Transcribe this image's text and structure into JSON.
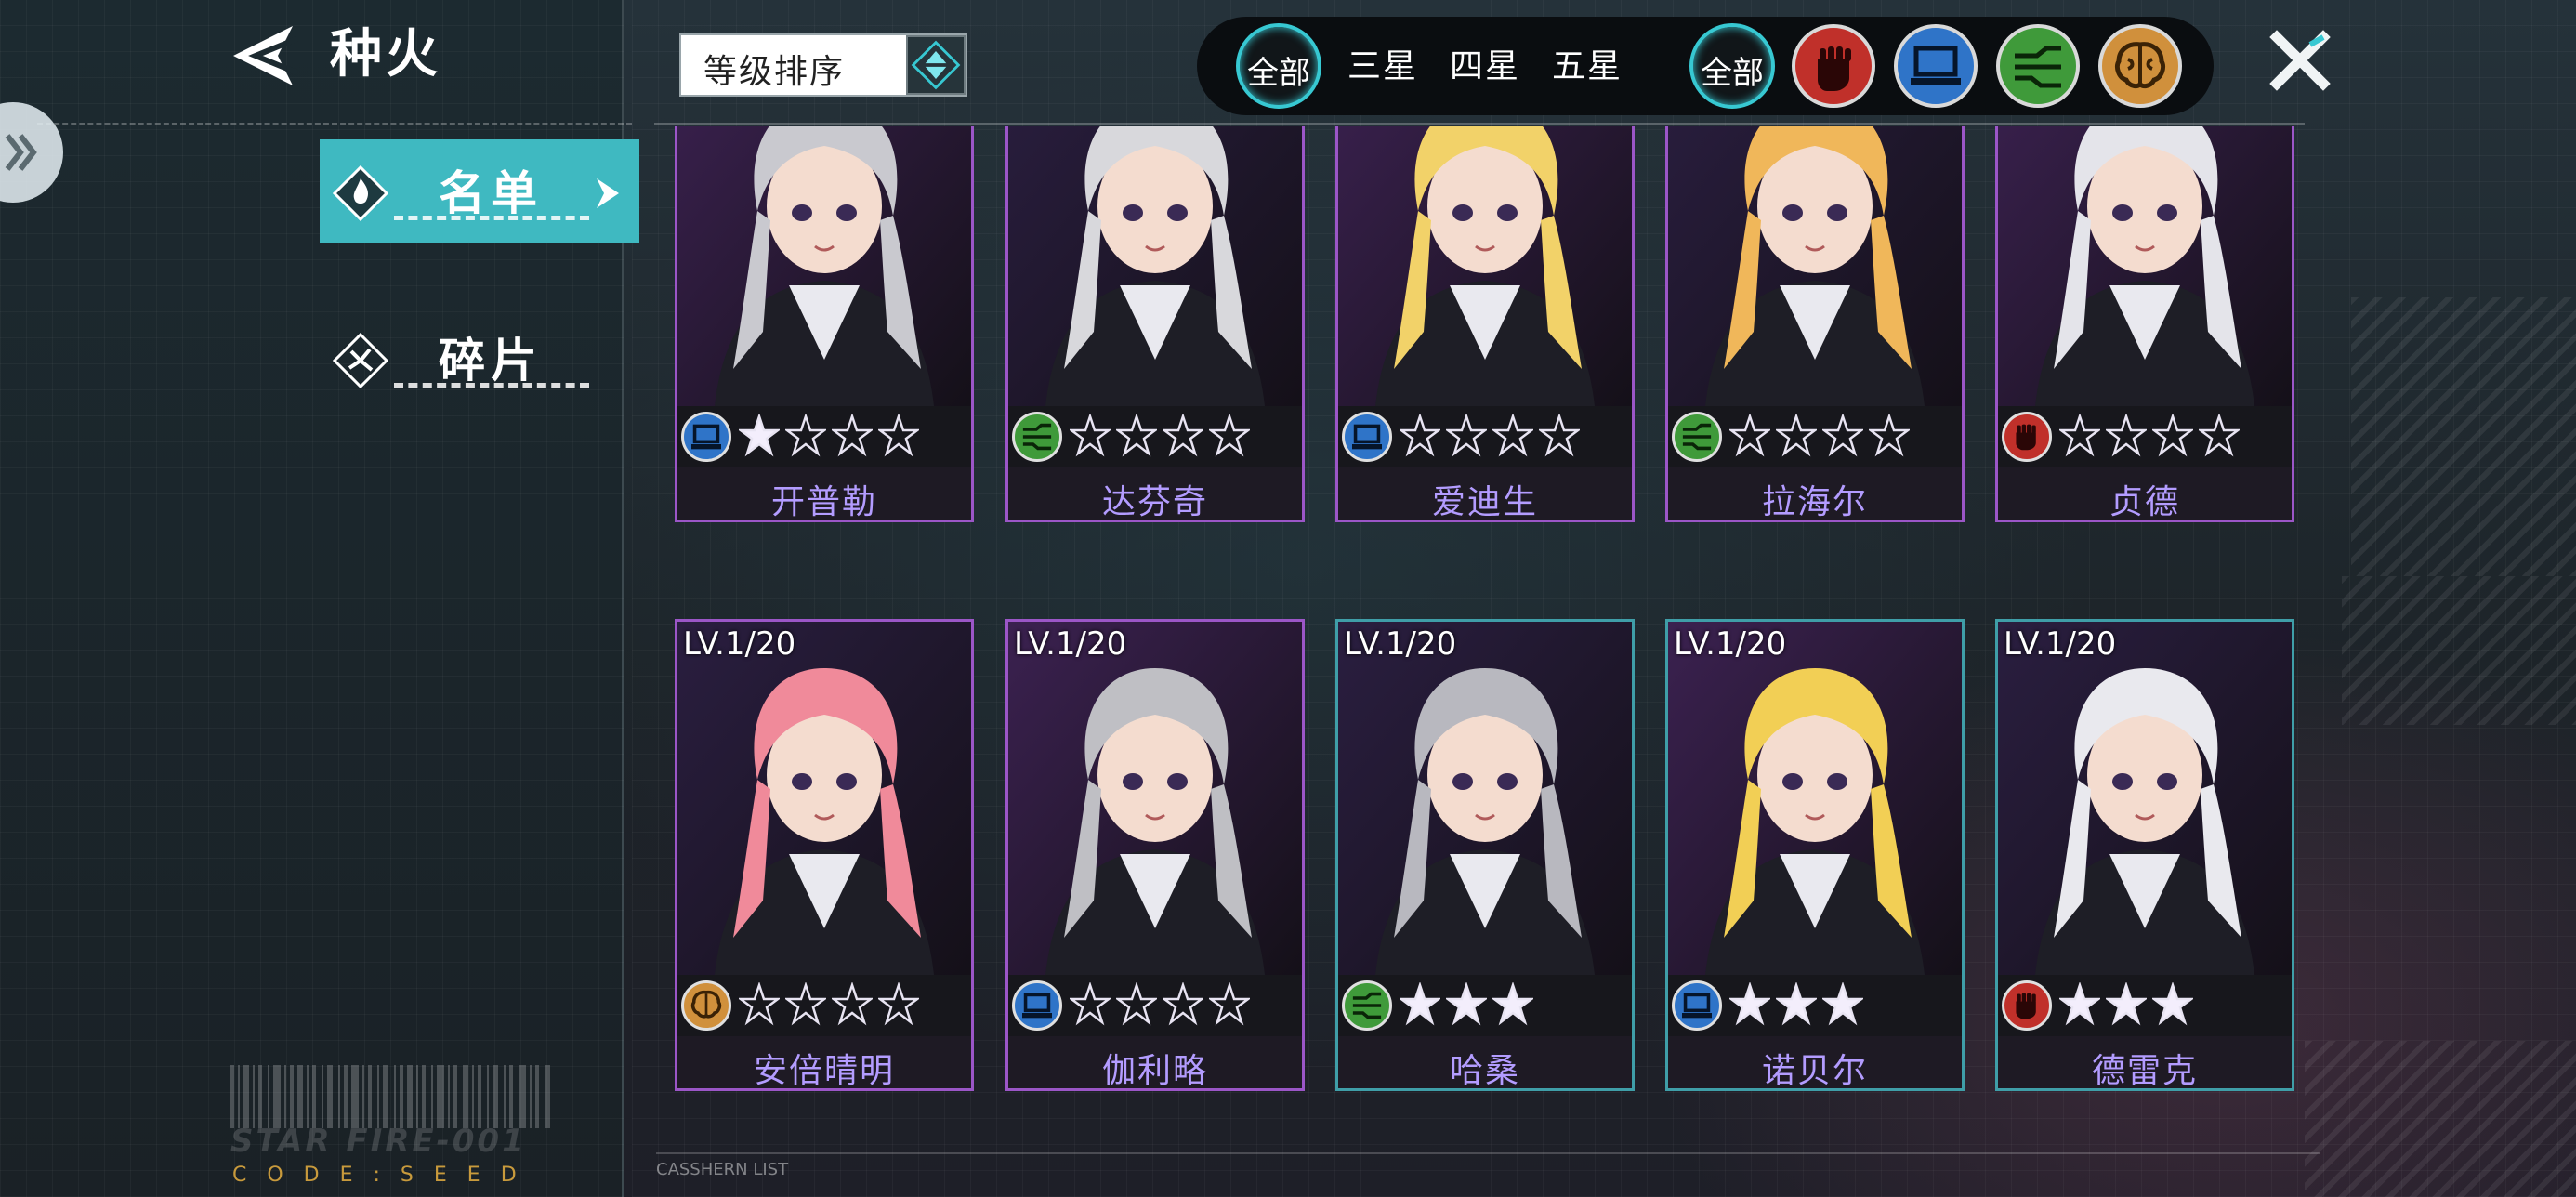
{
  "header": {
    "title": "种火"
  },
  "nav": {
    "tabs": [
      {
        "label": "名单",
        "selected": true
      },
      {
        "label": "碎片",
        "selected": false
      }
    ]
  },
  "sort": {
    "label": "等级排序"
  },
  "filters": {
    "rarity": [
      "全部",
      "三星",
      "四星",
      "五星"
    ],
    "type_all": "全部",
    "types": [
      {
        "icon": "fist-icon",
        "color": "#c0302a"
      },
      {
        "icon": "computer-icon",
        "color": "#2f74c8"
      },
      {
        "icon": "wave-icon",
        "color": "#3f9a3a"
      },
      {
        "icon": "brain-icon",
        "color": "#d0903c"
      }
    ],
    "accent_color": "#37c8d2"
  },
  "cards": [
    {
      "name": "开普勒",
      "level": "",
      "stars": 4,
      "filled_stars": 1,
      "type_icon": "computer-icon",
      "type_color": "#2f74c8",
      "hair": "#c9c9cf",
      "border": "purple"
    },
    {
      "name": "达芬奇",
      "level": "",
      "stars": 4,
      "filled_stars": 0,
      "type_icon": "wave-icon",
      "type_color": "#3f9a3a",
      "hair": "#d8d8dc",
      "border": "purple"
    },
    {
      "name": "爱迪生",
      "level": "",
      "stars": 4,
      "filled_stars": 0,
      "type_icon": "computer-icon",
      "type_color": "#2f74c8",
      "hair": "#f2d269",
      "border": "purple"
    },
    {
      "name": "拉海尔",
      "level": "",
      "stars": 4,
      "filled_stars": 0,
      "type_icon": "wave-icon",
      "type_color": "#3f9a3a",
      "hair": "#f0b75a",
      "border": "purple"
    },
    {
      "name": "贞德",
      "level": "",
      "stars": 4,
      "filled_stars": 0,
      "type_icon": "fist-icon",
      "type_color": "#c0302a",
      "hair": "#e4e4ea",
      "border": "purple"
    },
    {
      "name": "安倍晴明",
      "level": "LV.1/20",
      "stars": 4,
      "filled_stars": 0,
      "type_icon": "brain-icon",
      "type_color": "#d0903c",
      "hair": "#f08a9a",
      "border": "purple"
    },
    {
      "name": "伽利略",
      "level": "LV.1/20",
      "stars": 4,
      "filled_stars": 0,
      "type_icon": "computer-icon",
      "type_color": "#2f74c8",
      "hair": "#bfbfc4",
      "border": "purple"
    },
    {
      "name": "哈桑",
      "level": "LV.1/20",
      "stars": 3,
      "filled_stars": 3,
      "type_icon": "wave-icon",
      "type_color": "#3f9a3a",
      "hair": "#b8b8bf",
      "border": "teal"
    },
    {
      "name": "诺贝尔",
      "level": "LV.1/20",
      "stars": 3,
      "filled_stars": 3,
      "type_icon": "computer-icon",
      "type_color": "#2f74c8",
      "hair": "#f2cf55",
      "border": "teal"
    },
    {
      "name": "德雷克",
      "level": "LV.1/20",
      "stars": 3,
      "filled_stars": 3,
      "type_icon": "fist-icon",
      "type_color": "#c0302a",
      "hair": "#e9e9ee",
      "border": "teal"
    }
  ],
  "decor": {
    "brand": "STAR FIRE-001",
    "code": "CODE:SEED",
    "list_label": "CASSHERN LIST"
  }
}
